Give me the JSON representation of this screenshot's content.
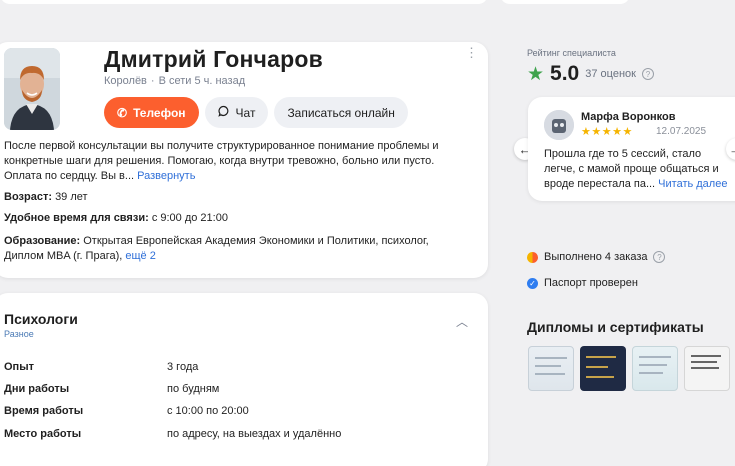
{
  "profile": {
    "name": "Дмитрий Гончаров",
    "city": "Королёв",
    "online": "В сети 5 ч. назад",
    "buttons": {
      "phone": "Телефон",
      "chat": "Чат",
      "book": "Записаться онлайн"
    },
    "description": "После первой консультации вы получите структурированное понимание проблемы и конкретные шаги для решения. Помогаю, когда внутри тревожно, больно или пусто. Оплата по сердцу. Вы в...",
    "expand_link": "Развернуть",
    "age_label": "Возраст:",
    "age_value": "39 лет",
    "time_label": "Удобное время для связи:",
    "time_value": "с 9:00 до 21:00",
    "edu_label": "Образование:",
    "edu_value": "Открытая Европейская Академия Экономики и Политики, психолог, Диплом MBA (г. Прага),",
    "edu_more": "ещё 2"
  },
  "section": {
    "title": "Психологи",
    "subtitle": "Разное",
    "rows": [
      {
        "key": "Опыт",
        "value": "3 года"
      },
      {
        "key": "Дни работы",
        "value": "по будням"
      },
      {
        "key": "Время работы",
        "value": "с 10:00 по 20:00"
      },
      {
        "key": "Место работы",
        "value": "по адресу, на выездах и удалённо"
      }
    ]
  },
  "rating": {
    "label": "Рейтинг специалиста",
    "score": "5.0",
    "count": "37 оценок"
  },
  "review": {
    "author": "Марфа Воронков",
    "stars": 5,
    "date": "12.07.2025",
    "text": "Прошла где то 5 сессий, стало легче, с мамой проще общаться и вроде перестала па...",
    "read_more": "Читать далее"
  },
  "stats": {
    "orders": "Выполнено 4 заказа",
    "passport": "Паспорт проверен"
  },
  "diplomas": {
    "title": "Дипломы и сертификаты"
  },
  "colors": {
    "accent": "#fc5f2e",
    "rating_star": "#3fa34d",
    "review_star": "#f5b400",
    "link": "#2f6fd8"
  }
}
